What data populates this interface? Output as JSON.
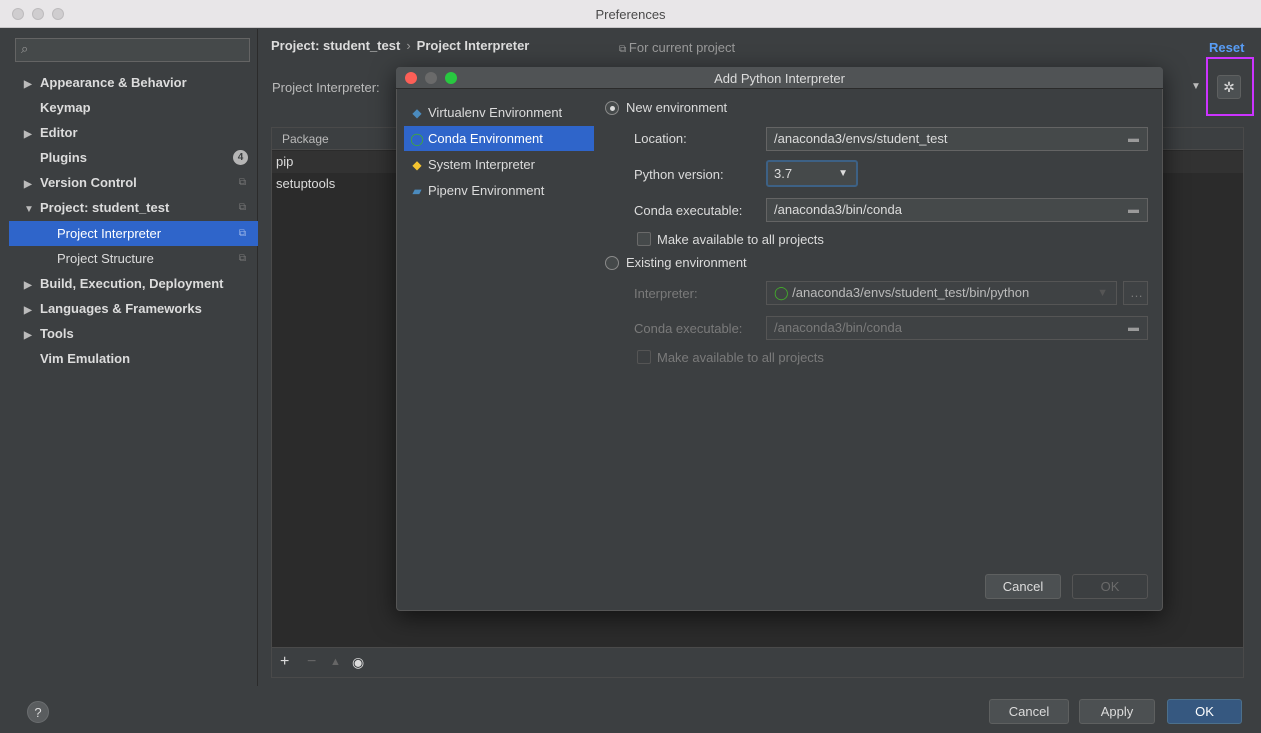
{
  "window": {
    "title": "Preferences"
  },
  "sidebar": {
    "search_placeholder": "",
    "items": [
      {
        "label": "Appearance & Behavior",
        "arrow": "▶"
      },
      {
        "label": "Keymap"
      },
      {
        "label": "Editor",
        "arrow": "▶"
      },
      {
        "label": "Plugins",
        "badge": "4"
      },
      {
        "label": "Version Control",
        "arrow": "▶"
      },
      {
        "label": "Project: student_test",
        "arrow": "▼"
      },
      {
        "label": "Project Interpreter",
        "selected": true
      },
      {
        "label": "Project Structure"
      },
      {
        "label": "Build, Execution, Deployment",
        "arrow": "▶"
      },
      {
        "label": "Languages & Frameworks",
        "arrow": "▶"
      },
      {
        "label": "Tools",
        "arrow": "▶"
      },
      {
        "label": "Vim Emulation"
      }
    ]
  },
  "header": {
    "breadcrumb_project": "Project: student_test",
    "breadcrumb_sep": "›",
    "breadcrumb_page": "Project Interpreter",
    "for_current": "For current project",
    "reset": "Reset",
    "interpreter_label": "Project Interpreter:"
  },
  "packages": {
    "column": "Package",
    "rows": [
      "pip",
      "setuptools"
    ]
  },
  "footer": {
    "cancel": "Cancel",
    "apply": "Apply",
    "ok": "OK",
    "help": "?"
  },
  "dialog": {
    "title": "Add Python Interpreter",
    "env_types": [
      {
        "label": "Virtualenv Environment",
        "icon": "virtualenv-icon"
      },
      {
        "label": "Conda Environment",
        "icon": "conda-icon",
        "selected": true
      },
      {
        "label": "System Interpreter",
        "icon": "python-icon"
      },
      {
        "label": "Pipenv Environment",
        "icon": "pipenv-icon"
      }
    ],
    "new_env": "New environment",
    "location_label": "Location:",
    "location_value": "/anaconda3/envs/student_test",
    "python_version_label": "Python version:",
    "python_version_value": "3.7",
    "conda_exec_label": "Conda executable:",
    "conda_exec_value": "/anaconda3/bin/conda",
    "make_available": "Make available to all projects",
    "existing_env": "Existing environment",
    "interpreter_label": "Interpreter:",
    "interpreter_value": "/anaconda3/envs/student_test/bin/python",
    "existing_conda_label": "Conda executable:",
    "existing_conda_value": "/anaconda3/bin/conda",
    "existing_make_available": "Make available to all projects",
    "cancel": "Cancel",
    "ok": "OK"
  },
  "colors": {
    "selection": "#2f65ca",
    "highlight": "#cc33ff",
    "link": "#589df6"
  }
}
